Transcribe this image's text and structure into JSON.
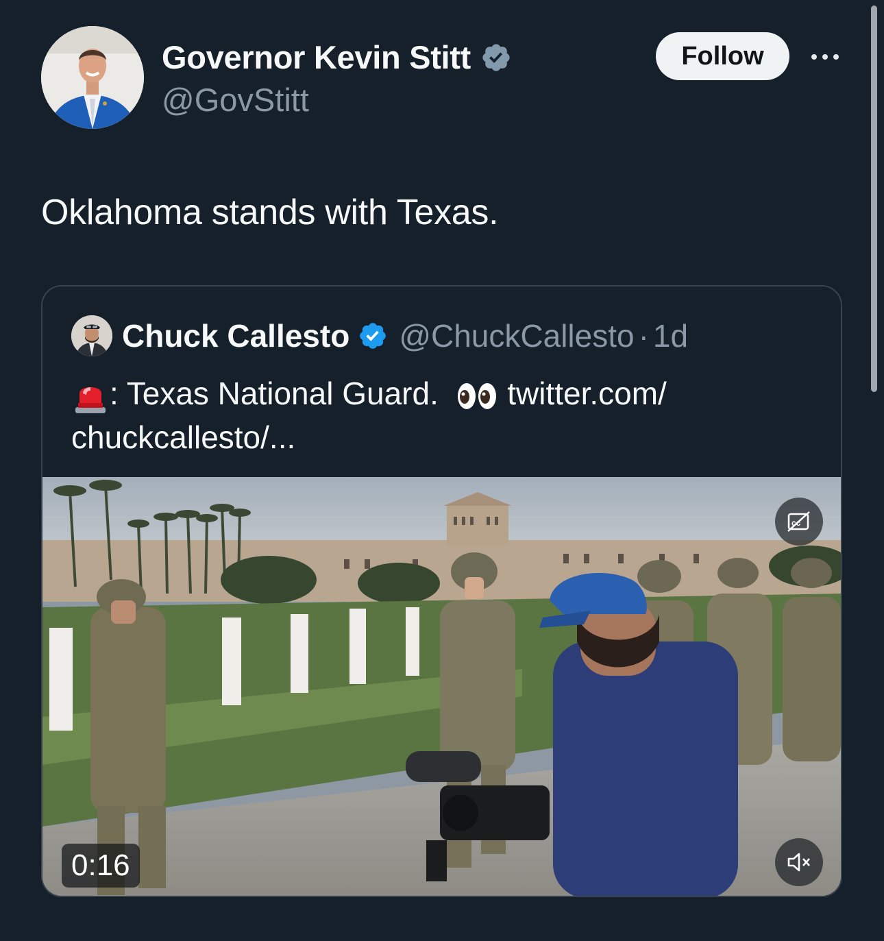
{
  "author": {
    "display_name": "Governor Kevin Stitt",
    "handle": "@GovStitt",
    "verified_icon": "verified-badge-gray-icon",
    "follow_label": "Follow",
    "more_icon": "more-options-icon"
  },
  "tweet": {
    "text": "Oklahoma stands with Texas."
  },
  "quote": {
    "display_name": "Chuck Callesto",
    "handle": "@ChuckCallesto",
    "separator": "·",
    "time": "1d",
    "verified_icon": "verified-badge-blue-icon",
    "text_part1": ": Texas National Guard.",
    "text_part2": "twitter.com/",
    "text_part3": "chuckcallesto/...",
    "emoji_siren": "siren-emoji",
    "emoji_eyes": "eyes-emoji",
    "media": {
      "duration": "0:16",
      "captions_icon": "captions-off-icon",
      "mute_icon": "volume-muted-icon"
    }
  },
  "colors": {
    "background": "#15202b",
    "text": "#f7f9f9",
    "secondary_text": "#8b98a5",
    "blue_verified": "#1d9bf0",
    "gray_verified": "#829aab",
    "border": "#38444d"
  }
}
